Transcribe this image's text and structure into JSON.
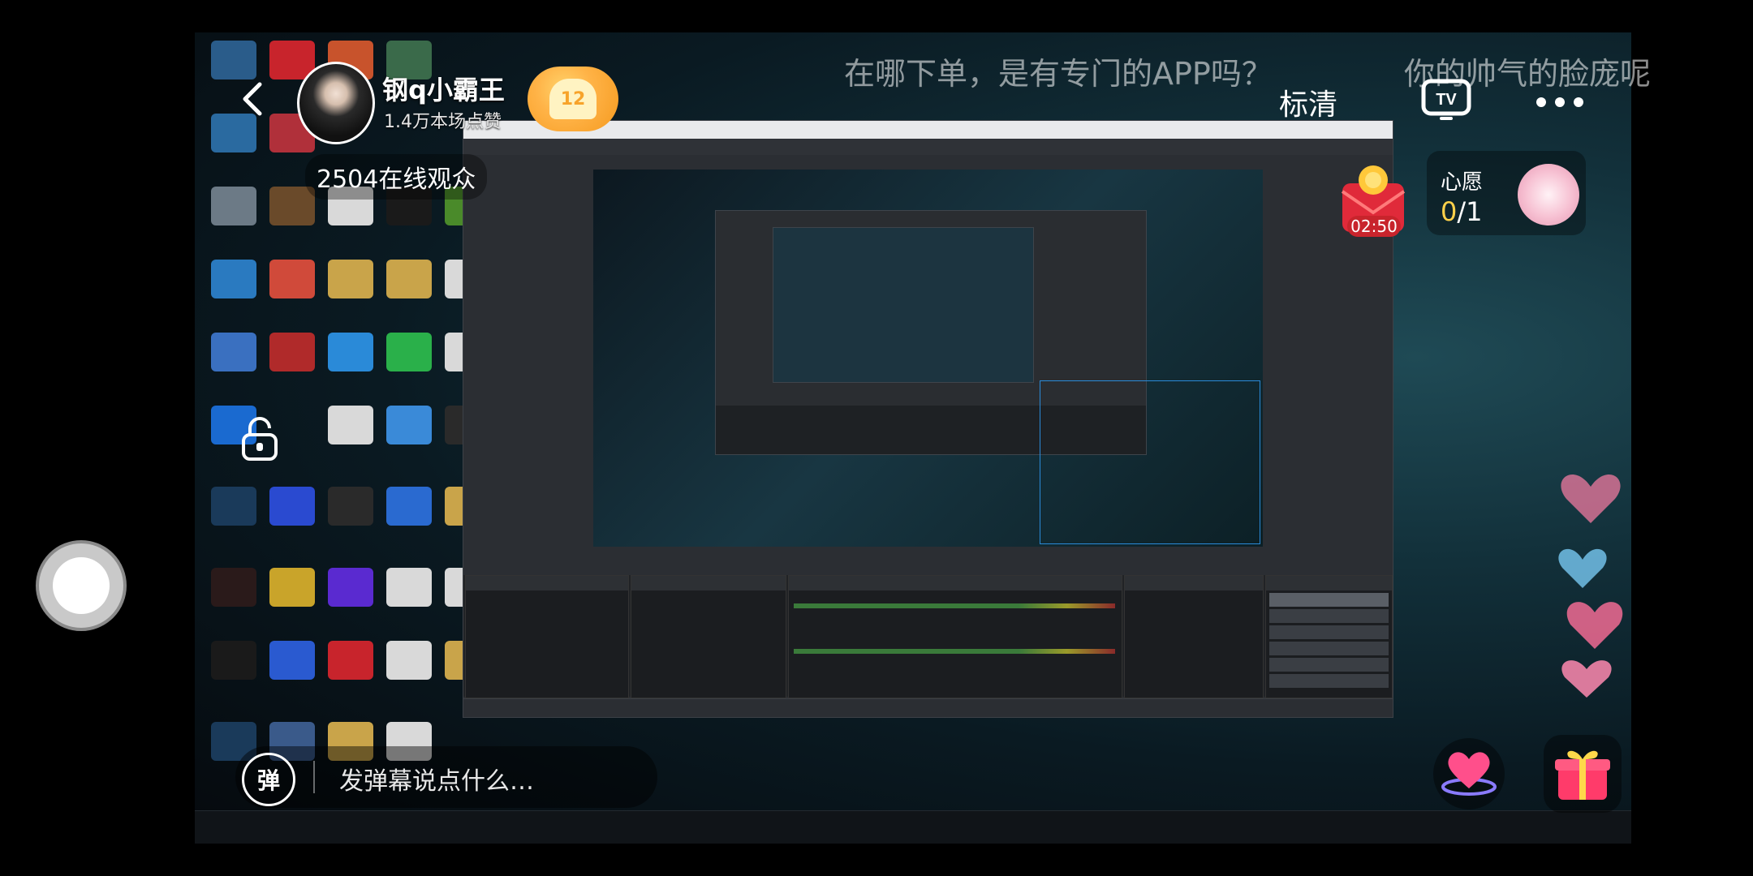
{
  "host": {
    "name": "钢q小霸王",
    "likes": "1.4万本场点赞",
    "badge_level": "12",
    "viewers": "2504在线观众"
  },
  "danmaku": [
    {
      "text": "在哪下单，是有专门的APP吗？"
    },
    {
      "text": "你的帅气的脸庞呢"
    }
  ],
  "top_bar": {
    "quality": "标清",
    "tv_icon": "tv-cast-icon",
    "more_icon": "more-dots-icon"
  },
  "gift_timer": "02:50",
  "wish": {
    "title": "心愿",
    "current": "0",
    "total": "/1"
  },
  "comment": {
    "toggle_label": "弹",
    "placeholder": "发弹幕说点什么…"
  },
  "colors": {
    "badge_orange": "#f59a1f",
    "timer_red": "#c8242c",
    "wish_yellow": "#ffd14a",
    "heart_pink": "#ff4f8b",
    "gift_red": "#ff3b6a"
  }
}
